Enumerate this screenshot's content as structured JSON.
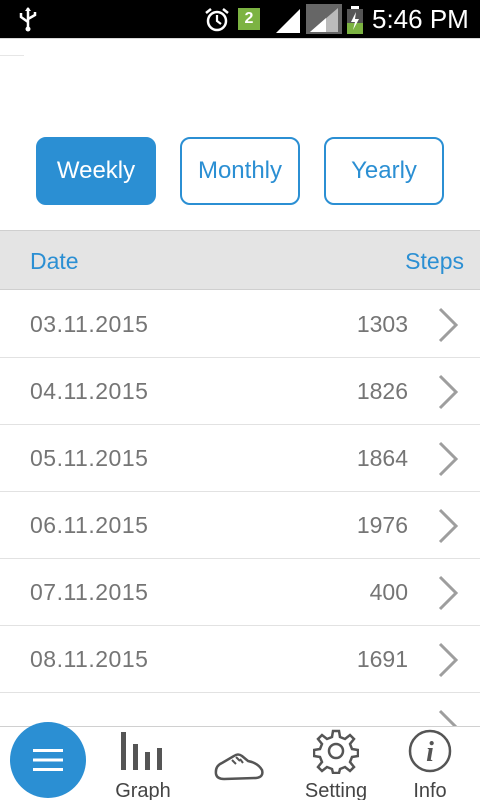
{
  "status_bar": {
    "time": "5:46 PM",
    "notification_count": "2",
    "icons": [
      "usb-icon",
      "alarm-icon",
      "notification-badge",
      "signal-icon",
      "signal-icon-2",
      "battery-charging-icon"
    ]
  },
  "period_tabs": [
    {
      "label": "Weekly",
      "active": true
    },
    {
      "label": "Monthly",
      "active": false
    },
    {
      "label": "Yearly",
      "active": false
    }
  ],
  "table": {
    "headers": {
      "date": "Date",
      "steps": "Steps"
    },
    "rows": [
      {
        "date": "03.11.2015",
        "steps": "1303"
      },
      {
        "date": "04.11.2015",
        "steps": "1826"
      },
      {
        "date": "05.11.2015",
        "steps": "1864"
      },
      {
        "date": "06.11.2015",
        "steps": "1976"
      },
      {
        "date": "07.11.2015",
        "steps": "400"
      },
      {
        "date": "08.11.2015",
        "steps": "1691"
      }
    ]
  },
  "bottom_nav": {
    "menu_icon": "menu-icon",
    "items": [
      {
        "label": "Graph",
        "icon": "bar-chart-icon"
      },
      {
        "label": "",
        "icon": "shoe-icon"
      },
      {
        "label": "Setting",
        "icon": "gear-icon"
      },
      {
        "label": "Info",
        "icon": "info-icon"
      }
    ]
  },
  "colors": {
    "accent": "#2b8fd3",
    "header_bg": "#e4e4e4",
    "row_text": "#757575"
  }
}
